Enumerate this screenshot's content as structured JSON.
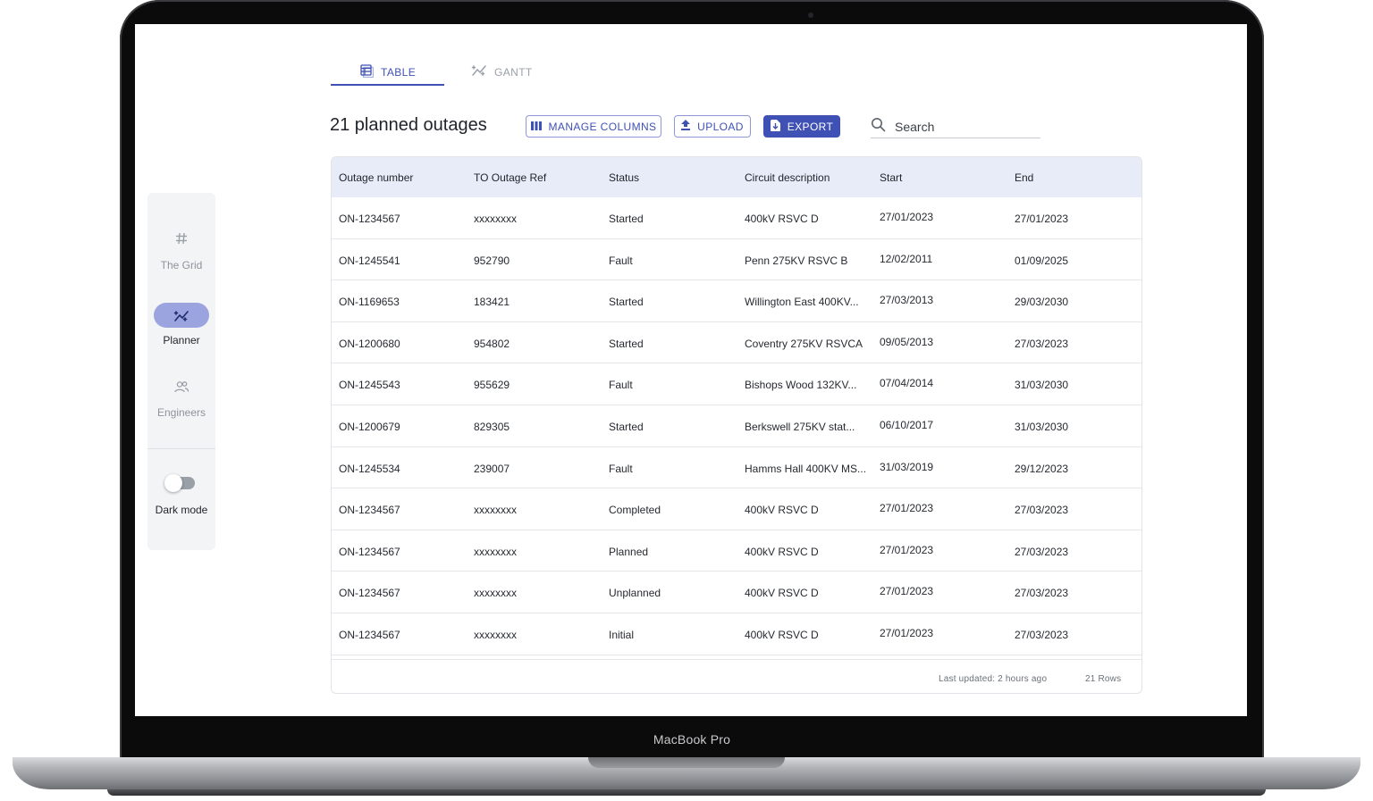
{
  "device": {
    "label": "MacBook Pro"
  },
  "sidebar": {
    "items": [
      {
        "label": "The Grid",
        "icon": "hash-icon"
      },
      {
        "label": "Planner",
        "icon": "planner-icon"
      },
      {
        "label": "Engineers",
        "icon": "engineers-icon"
      }
    ],
    "dark_mode_label": "Dark mode",
    "dark_mode_on": false
  },
  "tabs": [
    {
      "label": "TABLE",
      "icon": "table-icon",
      "active": true
    },
    {
      "label": "GANTT",
      "icon": "gantt-icon",
      "active": false
    }
  ],
  "toolbar": {
    "title": "21 planned outages",
    "manage_columns_label": "MANAGE COLUMNS",
    "upload_label": "UPLOAD",
    "export_label": "EXPORT",
    "search_placeholder": "Search"
  },
  "table": {
    "columns": [
      "Outage number",
      "TO Outage Ref",
      "Status",
      "Circuit description",
      "Start",
      "End"
    ],
    "rows": [
      [
        "ON-1234567",
        "xxxxxxxx",
        "Started",
        "400kV RSVC D",
        "27/01/2023",
        "27/01/2023"
      ],
      [
        "ON-1245541",
        "952790",
        "Fault",
        "Penn 275KV RSVC B",
        "12/02/2011",
        "01/09/2025"
      ],
      [
        "ON-1169653",
        "183421",
        "Started",
        "Willington East 400KV...",
        "27/03/2013",
        "29/03/2030"
      ],
      [
        "ON-1200680",
        "954802",
        "Started",
        "Coventry 275KV RSVCA",
        "09/05/2013",
        "27/03/2023"
      ],
      [
        "ON-1245543",
        "955629",
        "Fault",
        "Bishops Wood 132KV...",
        "07/04/2014",
        "31/03/2030"
      ],
      [
        "ON-1200679",
        "829305",
        "Started",
        "Berkswell 275KV stat...",
        "06/10/2017",
        "31/03/2030"
      ],
      [
        "ON-1245534",
        "239007",
        "Fault",
        "Hamms Hall 400KV MS...",
        "31/03/2019",
        "29/12/2023"
      ],
      [
        "ON-1234567",
        "xxxxxxxx",
        "Completed",
        "400kV RSVC D",
        "27/01/2023",
        "27/03/2023"
      ],
      [
        "ON-1234567",
        "xxxxxxxx",
        "Planned",
        "400kV RSVC D",
        "27/01/2023",
        "27/03/2023"
      ],
      [
        "ON-1234567",
        "xxxxxxxx",
        "Unplanned",
        "400kV RSVC D",
        "27/01/2023",
        "27/03/2023"
      ],
      [
        "ON-1234567",
        "xxxxxxxx",
        "Initial",
        "400kV RSVC D",
        "27/01/2023",
        "27/03/2023"
      ]
    ],
    "footer": {
      "last_updated": "Last updated: 2 hours ago",
      "row_count": "21 Rows"
    }
  },
  "colors": {
    "accent": "#3f51b5",
    "header_bg": "#e8ebf8",
    "planner_pill": "#9ba4df"
  }
}
